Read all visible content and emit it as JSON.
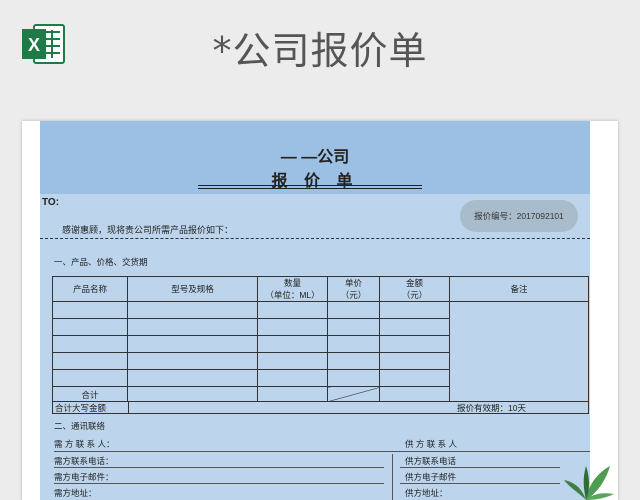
{
  "page": {
    "title": "*公司报价单"
  },
  "app_icon": {
    "name": "excel-icon",
    "letter": "X"
  },
  "sheet": {
    "company": "— —公司",
    "title": "报 价 单",
    "to_label": "TO:",
    "quote_no": "报价编号：2017092101",
    "thanks": "感谢惠顾，现将贵公司所需产品报价如下：",
    "section1": "一、产品、价格、交货期",
    "table": {
      "headers": {
        "name": "产品名称",
        "model": "型号及规格",
        "qty": "数量",
        "qty_unit": "（单位：ML）",
        "price": "单价",
        "price_unit": "（元）",
        "amount": "金额",
        "amount_unit": "（元）",
        "remark": "备注"
      },
      "total_label": "合计",
      "total_caps_label": "合计大写金额",
      "validity": "报价有效期：10天"
    },
    "section2": "二、通讯联络",
    "buyer": {
      "contact": "需 方 联 系 人：",
      "phone": "需方联系电话：",
      "email": "需方电子邮件：",
      "address": "需方地址："
    },
    "supplier": {
      "contact": "供 方 联 系 人",
      "phone": "供方联系电话",
      "email": "供方电子邮件",
      "address": "供方地址："
    }
  }
}
